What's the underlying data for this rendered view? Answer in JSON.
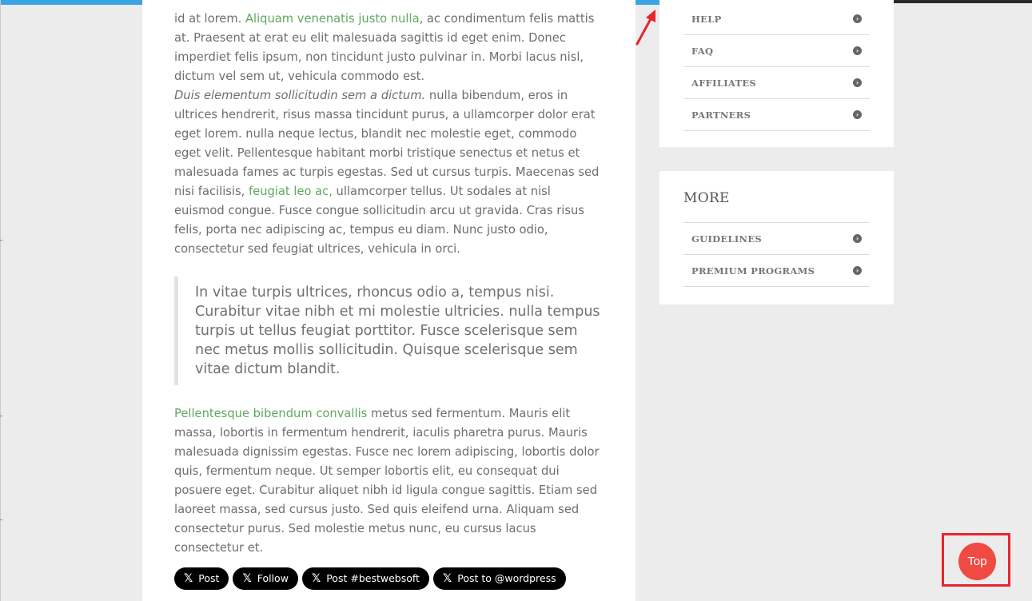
{
  "scroll_progress_percent": 69,
  "article": {
    "paragraph1": {
      "t1": "id at lorem. ",
      "link": "Aliquam venenatis justo nulla",
      "t2": ", ac condimentum felis mattis at. Praesent at erat eu elit malesuada sagittis id eget enim. Donec imperdiet felis ipsum, non tincidunt justo pulvinar in. Morbi lacus nisl, dictum vel sem ut, vehicula commodo est."
    },
    "paragraph2": {
      "italic": "Duis elementum sollicitudin sem a dictum.",
      "t1": " nulla bibendum, eros in ultrices hendrerit, risus massa tincidunt purus, a ullamcorper dolor erat eget lorem. nulla neque lectus, blandit nec molestie eget, commodo eget velit. Pellentesque habitant morbi tristique senectus et netus et malesuada fames ac turpis egestas. Sed ut cursus turpis. Maecenas sed nisi facilisis, ",
      "link": "feugiat leo ac,",
      "t2": " ullamcorper tellus. Ut sodales at nisl euismod congue. Fusce congue sollicitudin arcu ut gravida. Cras risus felis, porta nec adipiscing ac, tempus eu diam. Nunc justo odio, consectetur sed feugiat ultrices, vehicula in orci."
    },
    "blockquote": "In vitae turpis ultrices, rhoncus odio a, tempus nisi. Curabitur vitae nibh et mi molestie ultricies. nulla tempus turpis ut tellus feugiat porttitor. Fusce scelerisque sem nec metus mollis sollicitudin. Quisque scelerisque sem vitae dictum blandit.",
    "paragraph3": {
      "link": "Pellentesque bibendum convallis",
      "t1": " metus sed fermentum. Mauris elit massa, lobortis in fermentum hendrerit, iaculis pharetra purus. Mauris malesuada dignissim egestas. Fusce nec lorem adipiscing, lobortis dolor quis, fermentum neque. Ut semper lobortis elit, eu consequat dui posuere eget. Curabitur aliquet nibh id ligula congue sagittis. Etiam sed laoreet massa, sed cursus justo. Sed quis eleifend urna. Aliquam sed consectetur purus. Sed molestie metus nunc, eu cursus lacus consectetur et."
    },
    "share_buttons": [
      {
        "icon": "x-logo-icon",
        "glyph": "𝕏",
        "label": "Post"
      },
      {
        "icon": "x-logo-icon",
        "glyph": "𝕏",
        "label": "Follow"
      },
      {
        "icon": "x-logo-icon",
        "glyph": "𝕏",
        "label": "Post #bestwebsoft"
      },
      {
        "icon": "x-logo-icon",
        "glyph": "𝕏",
        "label": "Post to @wordpress"
      }
    ]
  },
  "sidebar": {
    "widget1": {
      "items": [
        {
          "label": "HELP"
        },
        {
          "label": "FAQ"
        },
        {
          "label": "AFFILIATES"
        },
        {
          "label": "PARTNERS"
        }
      ]
    },
    "widget2": {
      "title": "MORE",
      "items": [
        {
          "label": "GUIDELINES"
        },
        {
          "label": "PREMIUM PROGRAMS"
        }
      ]
    },
    "item_icon": "circle-arrow-right-icon",
    "item_glyph": "›"
  },
  "back_to_top": {
    "label": "Top"
  },
  "colors": {
    "link": "#5fa85f",
    "progress": "#3ba4e4",
    "top_button": "#f04a44",
    "highlight": "#e8252d"
  }
}
